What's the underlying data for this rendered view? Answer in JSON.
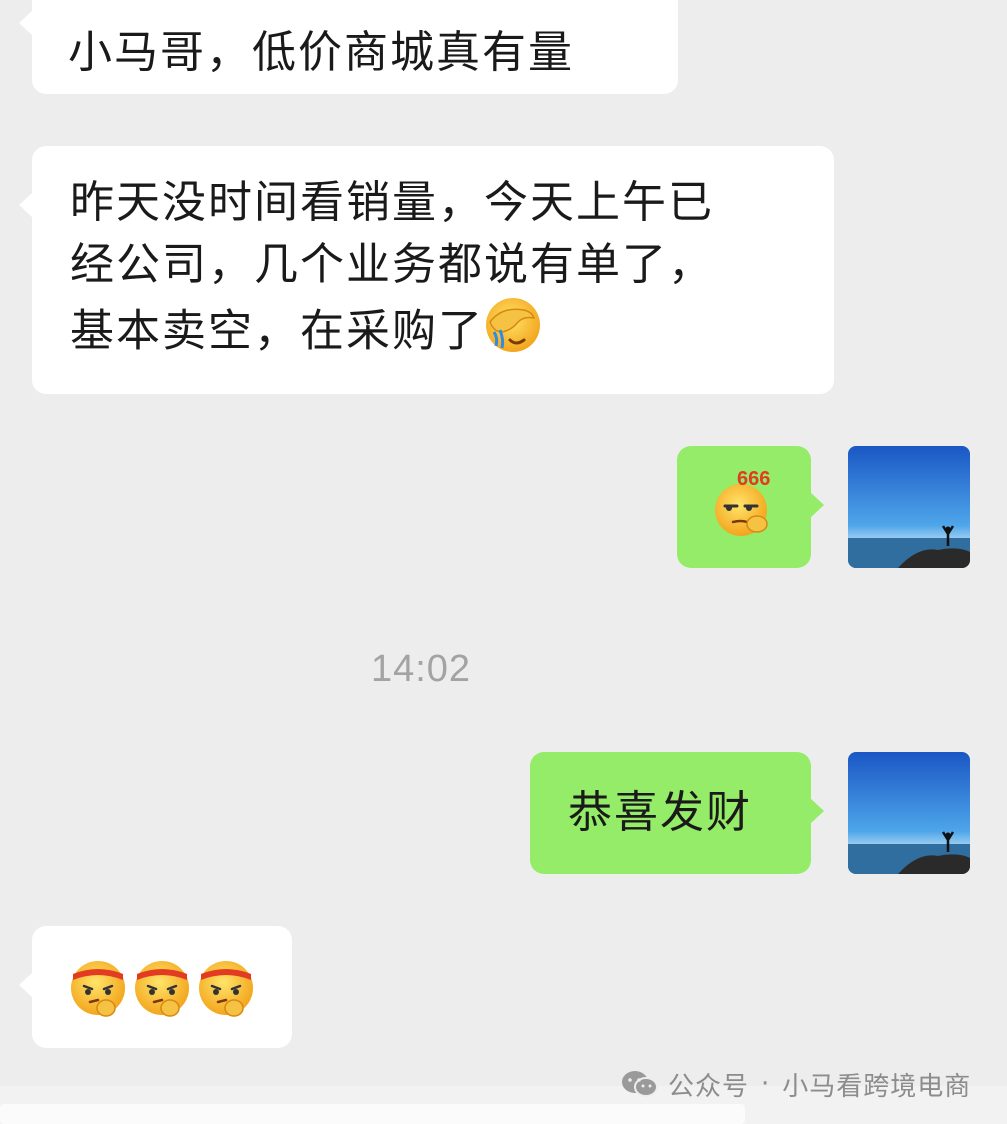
{
  "messages": [
    {
      "side": "in",
      "text": "小马哥，低价商城真有量"
    },
    {
      "side": "in",
      "lines": [
        "昨天没时间看销量，今天上午已",
        "经公司，几个业务都说有单了，",
        "基本卖空，在采购了"
      ],
      "trailing_emoji": "facepalm-emoji"
    },
    {
      "side": "out",
      "emoji": "666-emoji",
      "emoji_text": "666"
    },
    {
      "side": "out",
      "text": "恭喜发财"
    },
    {
      "side": "in",
      "emojis": [
        "determined-emoji",
        "determined-emoji",
        "determined-emoji"
      ]
    }
  ],
  "timestamp": "14:02",
  "watermark": {
    "prefix": "公众号",
    "separator": "·",
    "account": "小马看跨境电商",
    "icon": "wechat-icon"
  },
  "colors": {
    "background": "#ededed",
    "incoming_bubble": "#ffffff",
    "outgoing_bubble": "#95ec69",
    "timestamp": "#a3a3a3",
    "watermark": "#8c8c8c"
  }
}
